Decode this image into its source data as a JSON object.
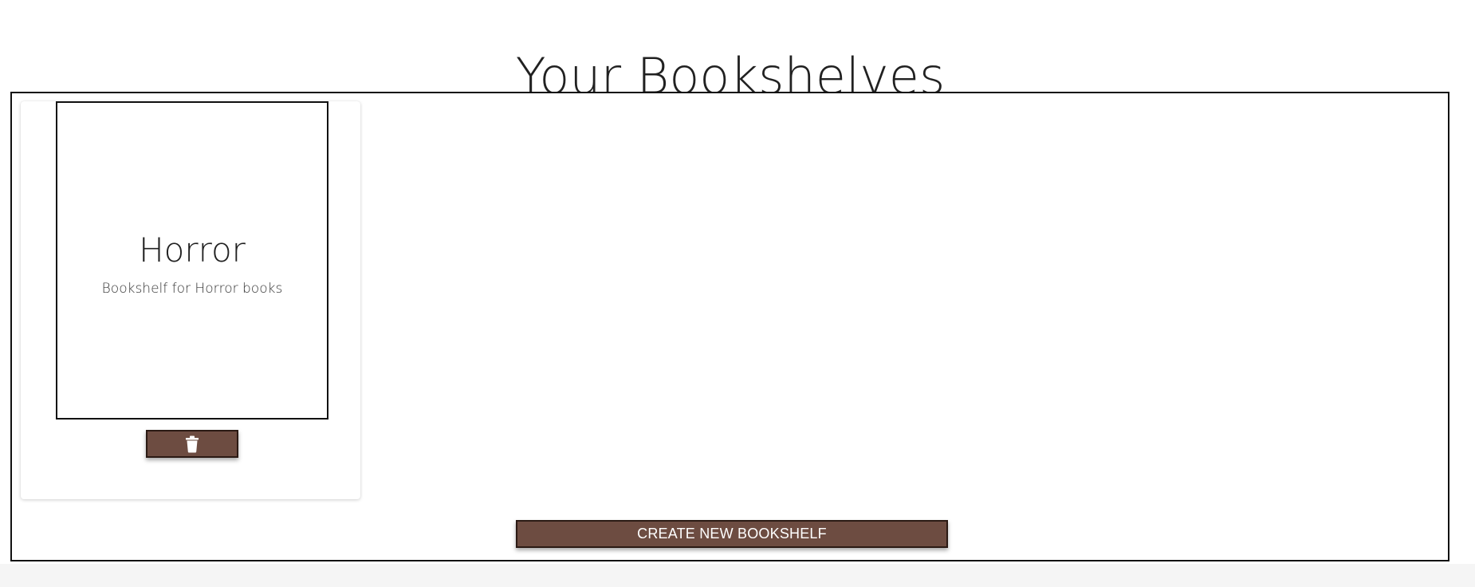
{
  "page": {
    "title": "Your Bookshelves",
    "background": "#ffffff",
    "footer_background": "#f5f5f5"
  },
  "bookshelves": [
    {
      "name": "Horror",
      "description": "Bookshelf for Horror books",
      "delete_icon": "trash-icon"
    }
  ],
  "actions": {
    "create_label": "CREATE NEW BOOKSHELF"
  },
  "colors": {
    "button_brown": "#6d4c41",
    "button_border": "#2b1a14",
    "button_text": "#ffffff"
  }
}
